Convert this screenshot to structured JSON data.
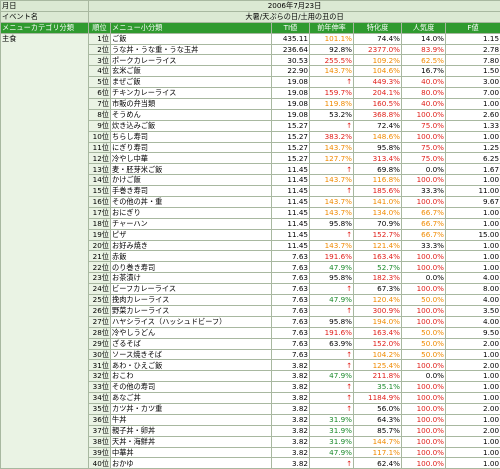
{
  "header": {
    "row1_label": "月日",
    "row1_value": "2006年7月23日",
    "row2_label": "イベント名",
    "row2_value": "大暑/天ぷらの日/土用の丑の日",
    "col_category": "メニューカテゴリ分類",
    "col_rank": "順位",
    "col_menu": "メニュー小分類",
    "col_ti": "TI値",
    "col_prev": "前年伸率",
    "col_spec": "特化度",
    "col_pop": "人気度",
    "col_f": "F値"
  },
  "category_label": "主食",
  "colors": {
    "red": "#e0201a",
    "orange": "#f08a00",
    "green": "#1a8a2a",
    "blue": "#1e5ec8",
    "header_green": "#2f9a2f"
  },
  "rows": [
    {
      "rank": "1位",
      "menu": "ご飯",
      "ti": "435.11",
      "prev": "101.1%",
      "prev_c": "orange",
      "spec": "74.4%",
      "spec_c": "black",
      "pop": "14.0%",
      "pop_c": "black",
      "f": "1.15"
    },
    {
      "rank": "2位",
      "menu": "うな丼・うな重・うな玉丼",
      "ti": "236.64",
      "prev": "92.8%",
      "prev_c": "black",
      "spec": "2377.0%",
      "spec_c": "red",
      "pop": "83.9%",
      "pop_c": "red",
      "f": "2.78"
    },
    {
      "rank": "3位",
      "menu": "ポークカレーライス",
      "ti": "30.53",
      "prev": "255.5%",
      "prev_c": "red",
      "spec": "109.2%",
      "spec_c": "orange",
      "pop": "62.5%",
      "pop_c": "orange",
      "f": "7.80"
    },
    {
      "rank": "4位",
      "menu": "玄米ご飯",
      "ti": "22.90",
      "prev": "143.7%",
      "prev_c": "orange",
      "spec": "104.6%",
      "spec_c": "orange",
      "pop": "16.7%",
      "pop_c": "black",
      "f": "1.50"
    },
    {
      "rank": "5位",
      "menu": "まぜご飯",
      "ti": "19.08",
      "prev": "↑",
      "prev_c": "red",
      "spec": "449.3%",
      "spec_c": "red",
      "pop": "40.0%",
      "pop_c": "red",
      "f": "3.00"
    },
    {
      "rank": "6位",
      "menu": "チキンカレーライス",
      "ti": "19.08",
      "prev": "159.7%",
      "prev_c": "red",
      "spec": "204.1%",
      "spec_c": "red",
      "pop": "80.0%",
      "pop_c": "red",
      "f": "7.00"
    },
    {
      "rank": "7位",
      "menu": "市販の弁当類",
      "ti": "19.08",
      "prev": "119.8%",
      "prev_c": "orange",
      "spec": "160.5%",
      "spec_c": "red",
      "pop": "40.0%",
      "pop_c": "red",
      "f": "1.00"
    },
    {
      "rank": "8位",
      "menu": "そうめん",
      "ti": "19.08",
      "prev": "53.2%",
      "prev_c": "black",
      "spec": "368.8%",
      "spec_c": "red",
      "pop": "100.0%",
      "pop_c": "red",
      "f": "2.60"
    },
    {
      "rank": "9位",
      "menu": "炊き込みご飯",
      "ti": "15.27",
      "prev": "↑",
      "prev_c": "red",
      "spec": "72.4%",
      "spec_c": "black",
      "pop": "75.0%",
      "pop_c": "red",
      "f": "1.33"
    },
    {
      "rank": "10位",
      "menu": "ちらし寿司",
      "ti": "15.27",
      "prev": "383.2%",
      "prev_c": "red",
      "spec": "148.6%",
      "spec_c": "orange",
      "pop": "100.0%",
      "pop_c": "red",
      "f": "1.00"
    },
    {
      "rank": "11位",
      "menu": "にぎり寿司",
      "ti": "15.27",
      "prev": "143.7%",
      "prev_c": "orange",
      "spec": "95.8%",
      "spec_c": "black",
      "pop": "75.0%",
      "pop_c": "red",
      "f": "1.25"
    },
    {
      "rank": "12位",
      "menu": "冷やし中華",
      "ti": "15.27",
      "prev": "127.7%",
      "prev_c": "orange",
      "spec": "313.4%",
      "prev_c2": "",
      "spec_c": "red",
      "pop": "75.0%",
      "pop_c": "red",
      "f": "6.25"
    },
    {
      "rank": "13位",
      "menu": "麦・胚芽米ご飯",
      "ti": "11.45",
      "prev": "↑",
      "prev_c": "red",
      "spec": "69.8%",
      "spec_c": "black",
      "pop": "0.0%",
      "pop_c": "black",
      "f": "1.67"
    },
    {
      "rank": "14位",
      "menu": "かけご飯",
      "ti": "11.45",
      "prev": "143.7%",
      "prev_c": "orange",
      "spec": "116.8%",
      "spec_c": "orange",
      "pop": "100.0%",
      "pop_c": "red",
      "f": "1.00"
    },
    {
      "rank": "15位",
      "menu": "手巻き寿司",
      "ti": "11.45",
      "prev": "↑",
      "prev_c": "red",
      "spec": "185.6%",
      "spec_c": "red",
      "pop": "33.3%",
      "pop_c": "black",
      "f": "11.00"
    },
    {
      "rank": "16位",
      "menu": "その他の丼・重",
      "ti": "11.45",
      "prev": "143.7%",
      "prev_c": "orange",
      "spec": "141.0%",
      "spec_c": "orange",
      "pop": "100.0%",
      "pop_c": "red",
      "f": "9.67"
    },
    {
      "rank": "17位",
      "menu": "おにぎり",
      "ti": "11.45",
      "prev": "143.7%",
      "prev_c": "orange",
      "spec": "134.0%",
      "spec_c": "orange",
      "pop": "66.7%",
      "pop_c": "orange",
      "f": "1.00"
    },
    {
      "rank": "18位",
      "menu": "チャーハン",
      "ti": "11.45",
      "prev": "95.8%",
      "prev_c": "black",
      "spec": "70.9%",
      "spec_c": "black",
      "pop": "66.7%",
      "pop_c": "orange",
      "f": "1.00"
    },
    {
      "rank": "19位",
      "menu": "ピザ",
      "ti": "11.45",
      "prev": "↑",
      "prev_c": "red",
      "spec": "152.7%",
      "spec_c": "red",
      "pop": "66.7%",
      "pop_c": "orange",
      "f": "15.00"
    },
    {
      "rank": "20位",
      "menu": "お好み焼き",
      "ti": "11.45",
      "prev": "143.7%",
      "prev_c": "orange",
      "spec": "121.4%",
      "spec_c": "orange",
      "pop": "33.3%",
      "pop_c": "black",
      "f": "1.00"
    },
    {
      "rank": "21位",
      "menu": "赤飯",
      "ti": "7.63",
      "prev": "191.6%",
      "prev_c": "red",
      "spec": "163.4%",
      "spec_c": "red",
      "pop": "100.0%",
      "pop_c": "red",
      "f": "1.00"
    },
    {
      "rank": "22位",
      "menu": "のり巻き寿司",
      "ti": "7.63",
      "prev": "47.9%",
      "prev_c": "green",
      "spec": "52.7%",
      "spec_c": "green",
      "pop": "100.0%",
      "pop_c": "red",
      "f": "1.00"
    },
    {
      "rank": "23位",
      "menu": "お茶漬け",
      "ti": "7.63",
      "prev": "95.8%",
      "prev_c": "black",
      "spec": "182.3%",
      "spec_c": "red",
      "pop": "0.0%",
      "pop_c": "black",
      "f": "4.00"
    },
    {
      "rank": "24位",
      "menu": "ビーフカレーライス",
      "ti": "7.63",
      "prev": "↑",
      "prev_c": "red",
      "spec": "67.3%",
      "spec_c": "black",
      "pop": "100.0%",
      "pop_c": "red",
      "f": "8.00"
    },
    {
      "rank": "25位",
      "menu": "挽肉カレーライス",
      "ti": "7.63",
      "prev": "47.9%",
      "prev_c": "green",
      "spec": "120.4%",
      "spec_c": "orange",
      "pop": "50.0%",
      "pop_c": "orange",
      "f": "4.00"
    },
    {
      "rank": "26位",
      "menu": "野菜カレーライス",
      "ti": "7.63",
      "prev": "↑",
      "prev_c": "red",
      "spec": "300.9%",
      "spec_c": "red",
      "pop": "100.0%",
      "pop_c": "red",
      "f": "3.50"
    },
    {
      "rank": "27位",
      "menu": "ハヤシライス（ハッシュドビーフ）",
      "ti": "7.63",
      "prev": "95.8%",
      "prev_c": "black",
      "spec": "194.0%",
      "spec_c": "orange",
      "pop": "100.0%",
      "pop_c": "red",
      "f": "4.00"
    },
    {
      "rank": "28位",
      "menu": "冷やしうどん",
      "ti": "7.63",
      "prev": "191.6%",
      "prev_c": "red",
      "spec": "163.4%",
      "spec_c": "red",
      "pop": "50.0%",
      "pop_c": "orange",
      "f": "9.50"
    },
    {
      "rank": "29位",
      "menu": "ざるそば",
      "ti": "7.63",
      "prev": "63.9%",
      "prev_c": "black",
      "spec": "152.0%",
      "spec_c": "red",
      "pop": "50.0%",
      "pop_c": "orange",
      "f": "2.00"
    },
    {
      "rank": "30位",
      "menu": "ソース焼きそば",
      "ti": "7.63",
      "prev": "↑",
      "prev_c": "red",
      "spec": "104.2%",
      "spec_c": "orange",
      "pop": "50.0%",
      "pop_c": "orange",
      "f": "1.00"
    },
    {
      "rank": "31位",
      "menu": "あわ・ひえご飯",
      "ti": "3.82",
      "prev": "↑",
      "prev_c": "red",
      "spec": "125.4%",
      "spec_c": "orange",
      "pop": "100.0%",
      "pop_c": "red",
      "f": "2.00"
    },
    {
      "rank": "32位",
      "menu": "おこわ",
      "ti": "3.82",
      "prev": "47.9%",
      "prev_c": "green",
      "spec": "211.8%",
      "spec_c": "red",
      "pop": "0.0%",
      "pop_c": "black",
      "f": "1.00"
    },
    {
      "rank": "33位",
      "menu": "その他の寿司",
      "ti": "3.82",
      "prev": "↑",
      "prev_c": "red",
      "spec": "35.1%",
      "spec_c": "green",
      "pop": "100.0%",
      "pop_c": "red",
      "f": "1.00"
    },
    {
      "rank": "34位",
      "menu": "あなご丼",
      "ti": "3.82",
      "prev": "↑",
      "prev_c": "red",
      "spec": "1184.9%",
      "spec_c": "red",
      "pop": "100.0%",
      "pop_c": "red",
      "f": "1.00"
    },
    {
      "rank": "35位",
      "menu": "カツ丼・カツ重",
      "ti": "3.82",
      "prev": "↑",
      "prev_c": "red",
      "spec": "56.0%",
      "spec_c": "black",
      "pop": "100.0%",
      "pop_c": "red",
      "f": "2.00"
    },
    {
      "rank": "36位",
      "menu": "牛丼",
      "ti": "3.82",
      "prev": "31.9%",
      "prev_c": "green",
      "spec": "64.3%",
      "spec_c": "black",
      "pop": "100.0%",
      "pop_c": "red",
      "f": "1.00"
    },
    {
      "rank": "37位",
      "menu": "親子丼・卵丼",
      "ti": "3.82",
      "prev": "31.9%",
      "prev_c": "green",
      "spec": "85.7%",
      "spec_c": "black",
      "pop": "100.0%",
      "pop_c": "red",
      "f": "2.00"
    },
    {
      "rank": "38位",
      "menu": "天丼・海鮮丼",
      "ti": "3.82",
      "prev": "31.9%",
      "prev_c": "green",
      "spec": "144.7%",
      "spec_c": "orange",
      "pop": "100.0%",
      "pop_c": "red",
      "f": "1.00"
    },
    {
      "rank": "39位",
      "menu": "中華丼",
      "ti": "3.82",
      "prev": "47.9%",
      "prev_c": "green",
      "spec": "117.1%",
      "spec_c": "orange",
      "pop": "100.0%",
      "pop_c": "red",
      "f": "1.00"
    },
    {
      "rank": "40位",
      "menu": "おかゆ",
      "ti": "3.82",
      "prev": "↑",
      "prev_c": "red",
      "spec": "62.4%",
      "spec_c": "black",
      "pop": "100.0%",
      "pop_c": "red",
      "f": "1.00"
    }
  ]
}
